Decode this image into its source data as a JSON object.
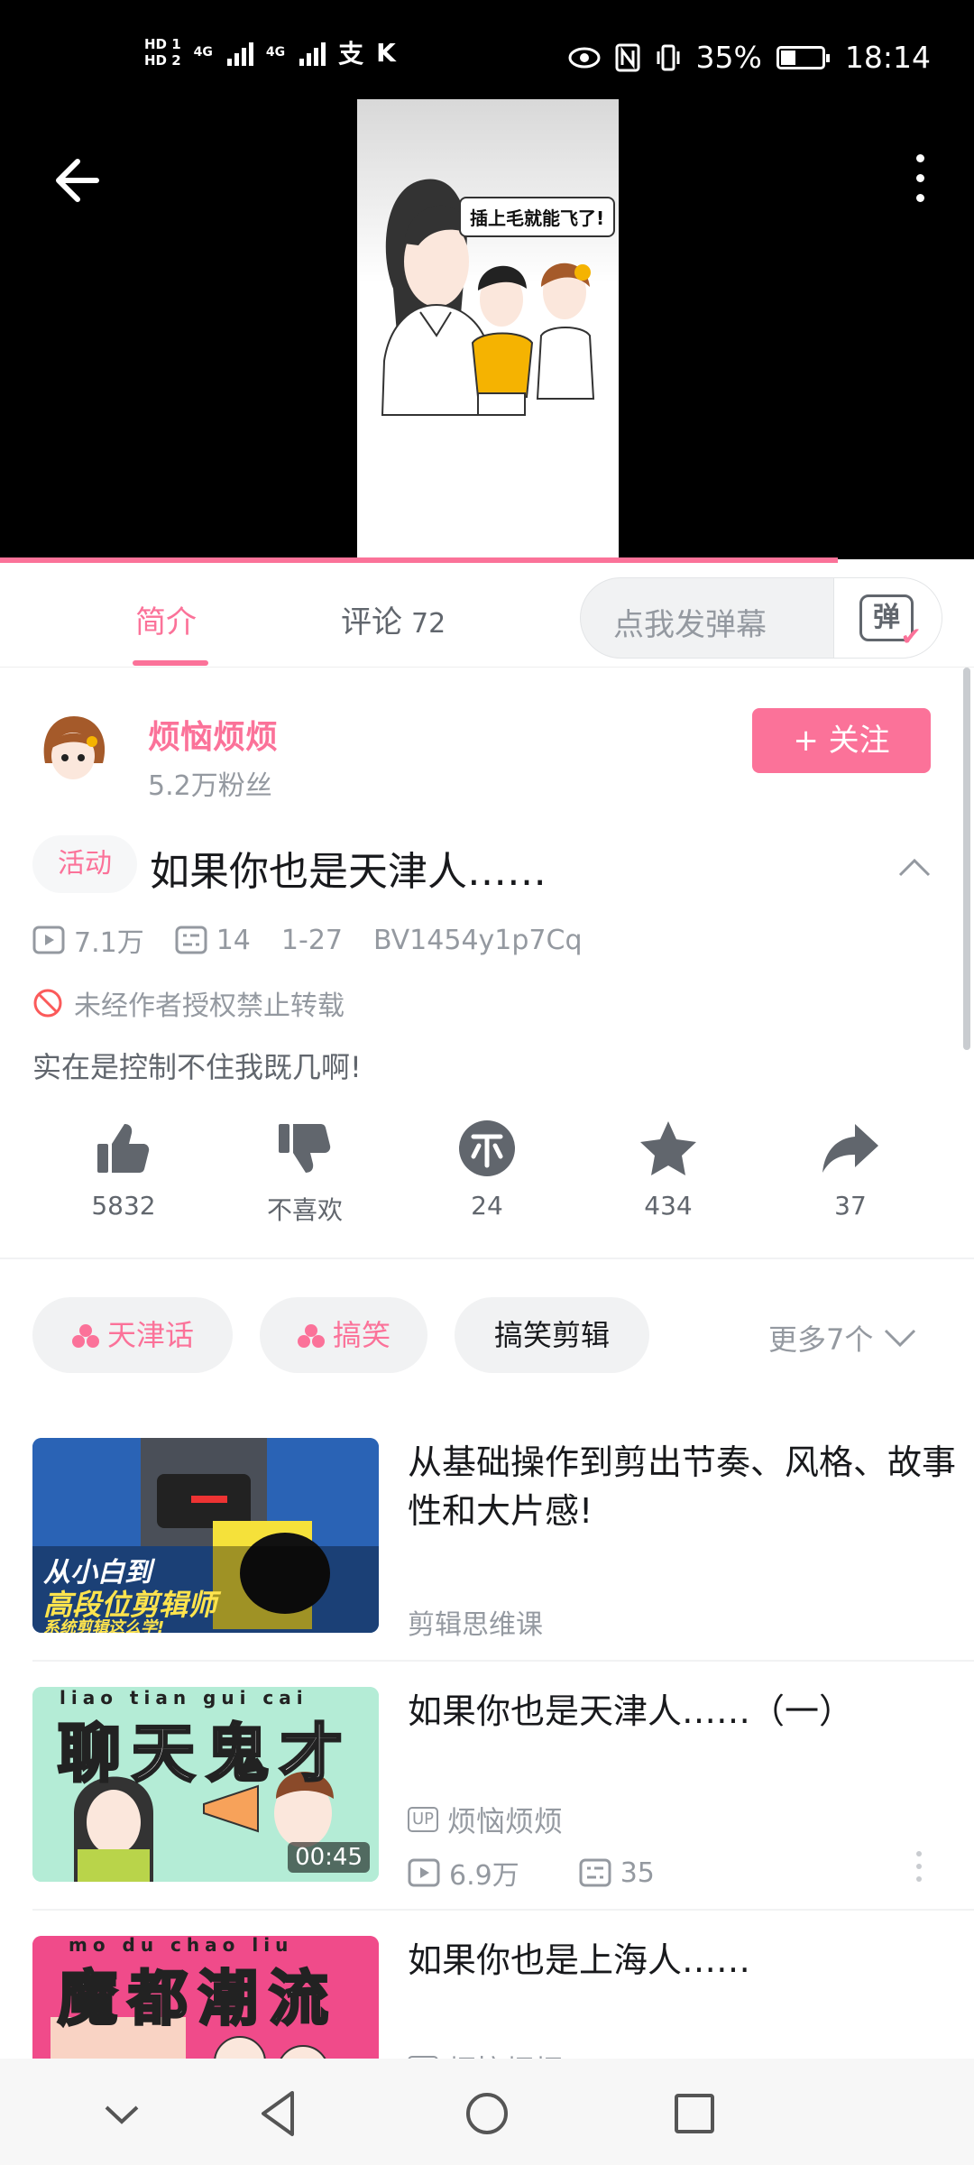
{
  "status_bar": {
    "hd1": "HD 1",
    "hd2": "HD 2",
    "net1": "4G",
    "net2": "4G",
    "battery": "35%",
    "time": "18:14"
  },
  "video": {
    "speech_bubble": "插上毛就能飞了!",
    "progress_fraction": 0.86
  },
  "tabs": {
    "intro": "简介",
    "comments": "评论",
    "comments_count": "72",
    "danmaku_placeholder": "点我发弹幕",
    "danmaku_button": "弹"
  },
  "author": {
    "name": "烦恼烦烦",
    "fans": "5.2万粉丝",
    "follow": "+ 关注"
  },
  "video_info": {
    "activity_tag": "活动",
    "title": "如果你也是天津人……",
    "views": "7.1万",
    "danmaku_count": "14",
    "date": "1-27",
    "bvid": "BV1454y1p7Cq",
    "copyright": "未经作者授权禁止转载",
    "description": "实在是控制不住我既几啊!"
  },
  "actions": {
    "like": "5832",
    "dislike": "不喜欢",
    "coin": "24",
    "favorite": "434",
    "share": "37"
  },
  "tags": {
    "items": [
      "天津话",
      "搞笑",
      "搞笑剪辑"
    ],
    "more": "更多7个"
  },
  "recommendations": [
    {
      "title": "从基础操作到剪出节奏、风格、故事性和大片感!",
      "subtitle": "剪辑思维课",
      "thumb_line1": "从小白到",
      "thumb_line2": "高段位剪辑师",
      "thumb_line3": "系统剪辑这么学!"
    },
    {
      "title": "如果你也是天津人……（一）",
      "up_badge": "UP",
      "up_name": "烦恼烦烦",
      "views": "6.9万",
      "danmaku": "35",
      "duration": "00:45",
      "thumb_text": "聊天鬼才",
      "thumb_pinyin": "liao  tian  gui  cai"
    },
    {
      "title": "如果你也是上海人……",
      "up_badge": "UP",
      "up_name": "烦恼烦烦",
      "thumb_text": "魔都潮流",
      "thumb_pinyin": "mo  du  chao  liu"
    }
  ]
}
